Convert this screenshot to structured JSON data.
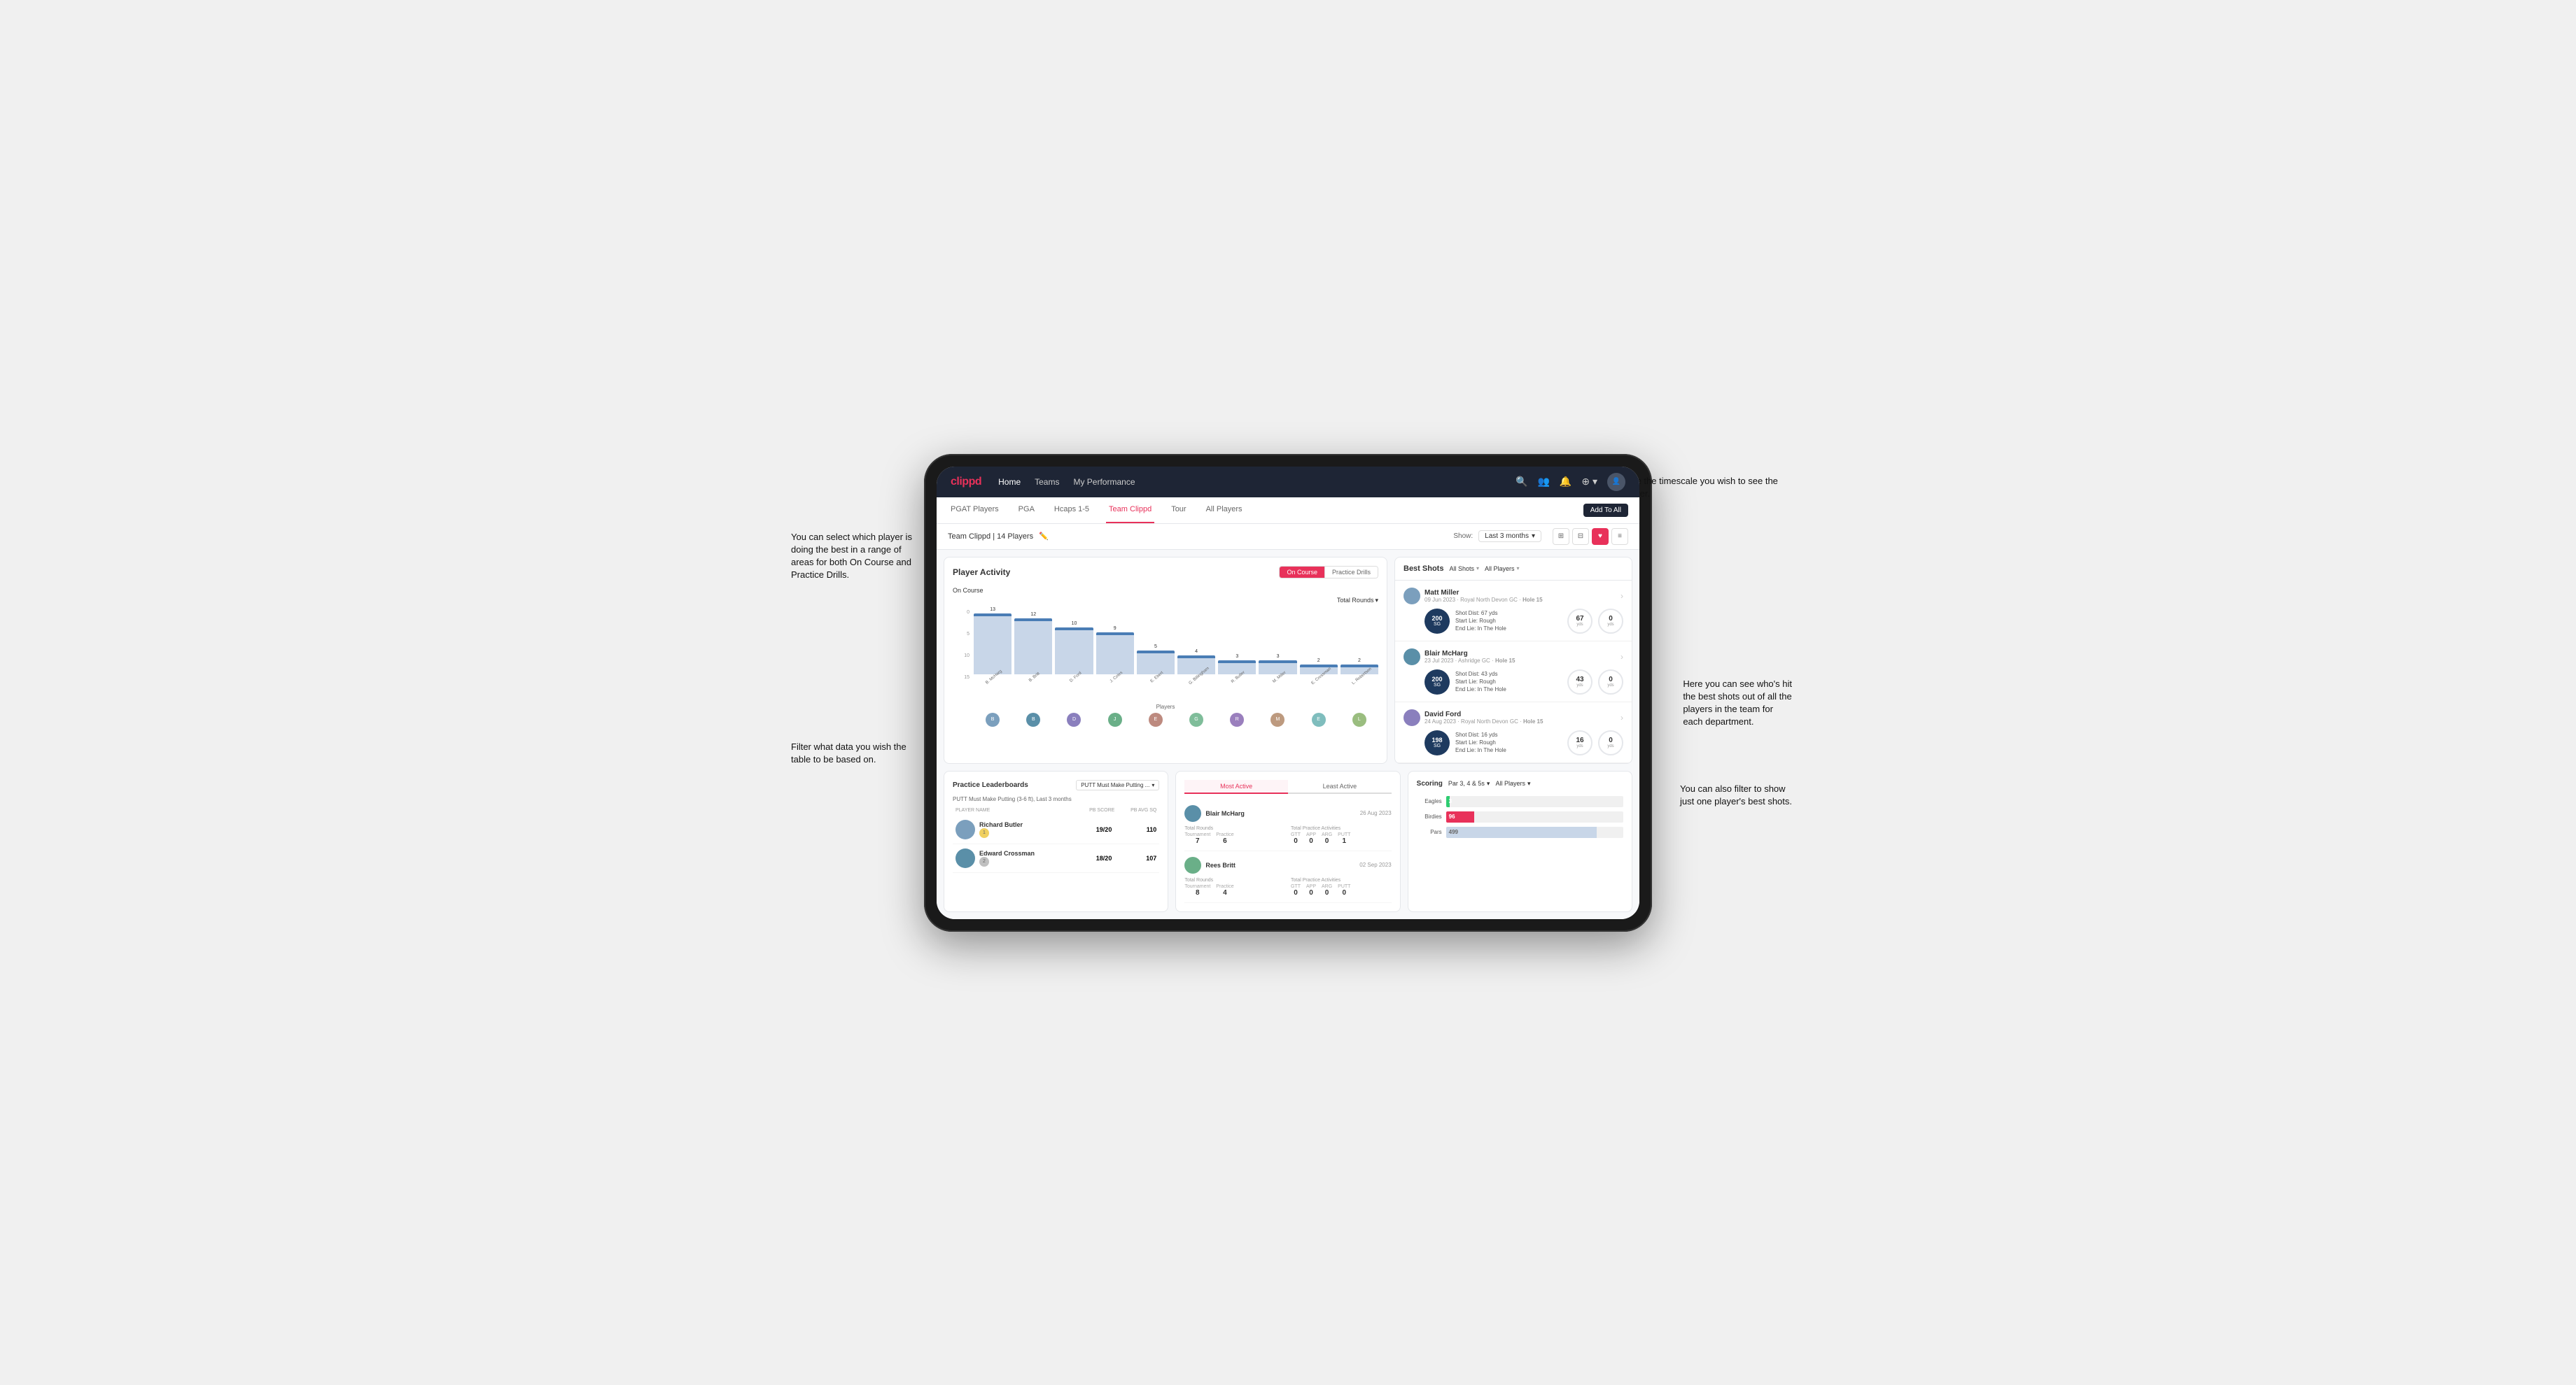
{
  "annotations": {
    "top_right": "Choose the timescale you\nwish to see the data over.",
    "left_top": "You can select which player is\ndoing the best in a range of\nareas for both On Course and\nPractice Drills.",
    "left_bottom": "Filter what data you wish the\ntable to be based on.",
    "right_mid": "Here you can see who's hit\nthe best shots out of all the\nplayers in the team for\neach department.",
    "right_bottom": "You can also filter to show\njust one player's best shots."
  },
  "nav": {
    "logo": "clippd",
    "items": [
      "Home",
      "Teams",
      "My Performance"
    ],
    "icons": [
      "search",
      "users",
      "bell",
      "add",
      "profile"
    ]
  },
  "tabs": {
    "items": [
      "PGAT Players",
      "PGA",
      "Hcaps 1-5",
      "Team Clippd",
      "Tour",
      "All Players"
    ],
    "active": "Team Clippd",
    "add_button": "Add To All"
  },
  "team_header": {
    "title": "Team Clippd",
    "player_count": "14 Players",
    "show_label": "Show:",
    "show_value": "Last 3 months",
    "view_options": [
      "grid-2",
      "grid-3",
      "heart",
      "list"
    ]
  },
  "player_activity": {
    "title": "Player Activity",
    "toggle_options": [
      "On Course",
      "Practice Drills"
    ],
    "active_toggle": "On Course",
    "chart_label": "On Course",
    "y_axis_label": "Total Rounds",
    "x_axis_label": "Players",
    "dropdown_label": "Total Rounds",
    "y_axis_values": [
      "0",
      "5",
      "10",
      "15"
    ],
    "bars": [
      {
        "name": "B. McHarg",
        "value": 13,
        "height": 100
      },
      {
        "name": "B. Britt",
        "value": 12,
        "height": 92
      },
      {
        "name": "D. Ford",
        "value": 10,
        "height": 77
      },
      {
        "name": "J. Coles",
        "value": 9,
        "height": 69
      },
      {
        "name": "E. Ebert",
        "value": 5,
        "height": 38
      },
      {
        "name": "G. Billingham",
        "value": 4,
        "height": 31
      },
      {
        "name": "R. Butler",
        "value": 3,
        "height": 23
      },
      {
        "name": "M. Miller",
        "value": 3,
        "height": 23
      },
      {
        "name": "E. Crossman",
        "value": 2,
        "height": 15
      },
      {
        "name": "L. Robertson",
        "value": 2,
        "height": 15
      }
    ],
    "avatar_colors": [
      "#7b9fbd",
      "#5a8fa8",
      "#8a7fbd",
      "#6aaf88",
      "#bd8a7f",
      "#7fbd9a",
      "#9a7fbd",
      "#bd9a7f",
      "#7fbdbd",
      "#9abd7f"
    ]
  },
  "best_shots": {
    "title": "Best Shots",
    "filter1_label": "All Shots",
    "filter2_label": "All Players",
    "players": [
      {
        "name": "Matt Miller",
        "date": "09 Jun 2023",
        "course": "Royal North Devon GC",
        "hole": "Hole 15",
        "badge": "200",
        "badge_sub": "SG",
        "shot_dist": "Shot Dist: 67 yds",
        "start_lie": "Start Lie: Rough",
        "end_lie": "End Lie: In The Hole",
        "stat1_value": "67",
        "stat1_unit": "yds",
        "stat2_value": "0",
        "stat2_unit": "yds",
        "avatar_color": "#7b9fbd"
      },
      {
        "name": "Blair McHarg",
        "date": "23 Jul 2023",
        "course": "Ashridge GC",
        "hole": "Hole 15",
        "badge": "200",
        "badge_sub": "SG",
        "shot_dist": "Shot Dist: 43 yds",
        "start_lie": "Start Lie: Rough",
        "end_lie": "End Lie: In The Hole",
        "stat1_value": "43",
        "stat1_unit": "yds",
        "stat2_value": "0",
        "stat2_unit": "yds",
        "avatar_color": "#5a8fa8"
      },
      {
        "name": "David Ford",
        "date": "24 Aug 2023",
        "course": "Royal North Devon GC",
        "hole": "Hole 15",
        "badge": "198",
        "badge_sub": "SG",
        "shot_dist": "Shot Dist: 16 yds",
        "start_lie": "Start Lie: Rough",
        "end_lie": "End Lie: In The Hole",
        "stat1_value": "16",
        "stat1_unit": "yds",
        "stat2_value": "0",
        "stat2_unit": "yds",
        "avatar_color": "#8a7fbd"
      }
    ]
  },
  "practice_leaderboards": {
    "title": "Practice Leaderboards",
    "dropdown_label": "PUTT Must Make Putting ...",
    "subtitle": "PUTT Must Make Putting (3-6 ft), Last 3 months",
    "columns": [
      "PLAYER NAME",
      "PB SCORE",
      "PB AVG SQ"
    ],
    "players": [
      {
        "name": "Richard Butler",
        "rank": "1",
        "rank_type": "gold",
        "pb_score": "19/20",
        "pb_avg_sq": "110",
        "avatar_color": "#7b9fbd"
      },
      {
        "name": "Edward Crossman",
        "rank": "2",
        "rank_type": "silver",
        "pb_score": "18/20",
        "pb_avg_sq": "107",
        "avatar_color": "#5a8fa8"
      }
    ]
  },
  "most_active": {
    "tabs": [
      "Most Active",
      "Least Active"
    ],
    "active_tab": "Most Active",
    "players": [
      {
        "name": "Blair McHarg",
        "date": "26 Aug 2023",
        "total_rounds_label": "Total Rounds",
        "tournament": "7",
        "practice": "6",
        "practice_activities_label": "Total Practice Activities",
        "gtt": "0",
        "app": "0",
        "arg": "0",
        "putt": "1",
        "avatar_color": "#5a8fa8"
      },
      {
        "name": "Rees Britt",
        "date": "02 Sep 2023",
        "total_rounds_label": "Total Rounds",
        "tournament": "8",
        "practice": "4",
        "practice_activities_label": "Total Practice Activities",
        "gtt": "0",
        "app": "0",
        "arg": "0",
        "putt": "0",
        "avatar_color": "#6aaf88"
      }
    ]
  },
  "scoring": {
    "title": "Scoring",
    "filter1_label": "Par 3, 4 & 5s",
    "filter2_label": "All Players",
    "bars": [
      {
        "label": "Eagles",
        "value": 3,
        "pct": 2,
        "color": "#2ecc71",
        "type": "eagles"
      },
      {
        "label": "Birdies",
        "value": 96,
        "pct": 16,
        "color": "#e8315a",
        "type": "birdies"
      },
      {
        "label": "Pars",
        "value": 499,
        "pct": 85,
        "color": "#c8d6e8",
        "type": "pars"
      }
    ]
  }
}
